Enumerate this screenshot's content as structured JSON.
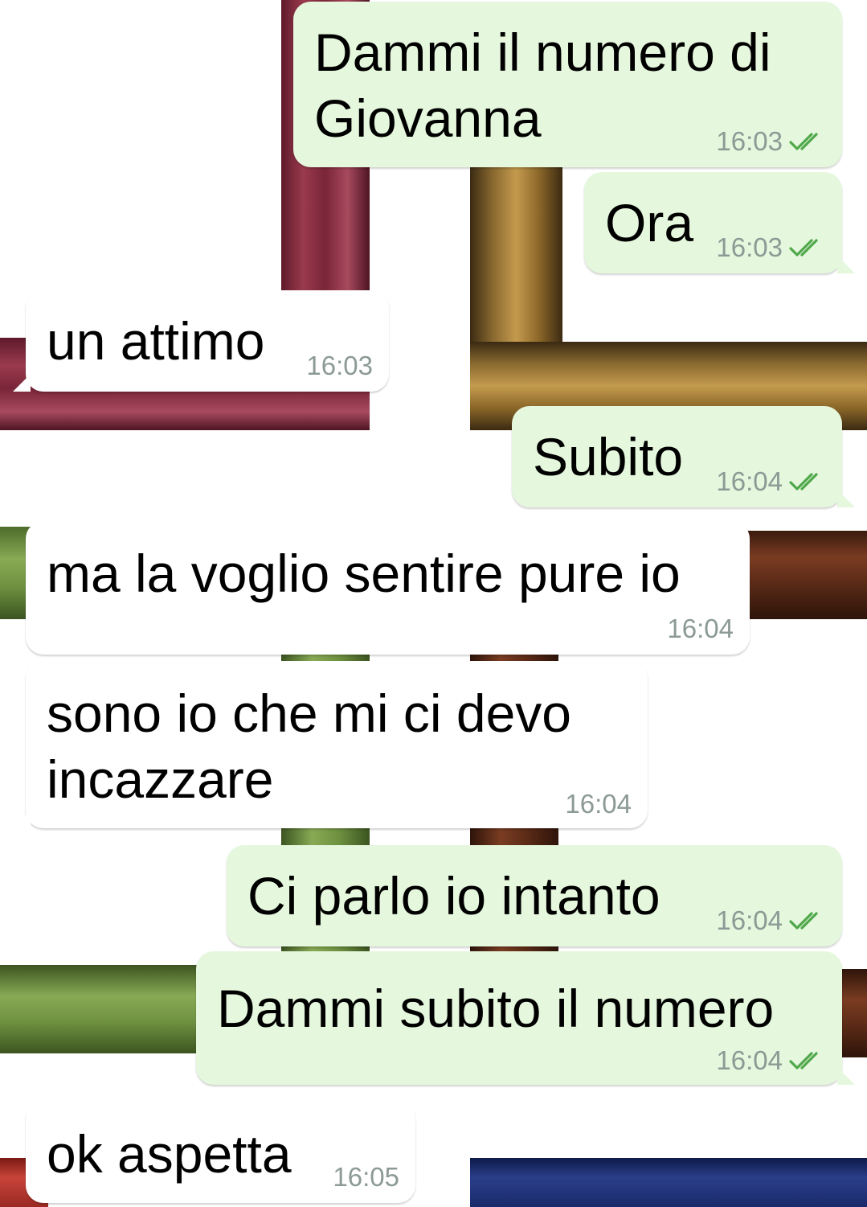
{
  "chat": {
    "messages": [
      {
        "text": "Dammi il numero di\nGiovanna",
        "time": "16:03",
        "direction": "outgoing",
        "status": "read"
      },
      {
        "text": "Ora",
        "time": "16:03",
        "direction": "outgoing",
        "status": "read"
      },
      {
        "text": "un attimo",
        "time": "16:03",
        "direction": "incoming"
      },
      {
        "text": "Subito",
        "time": "16:04",
        "direction": "outgoing",
        "status": "read"
      },
      {
        "text": "ma la voglio sentire pure io",
        "time": "16:04",
        "direction": "incoming"
      },
      {
        "text": "sono io che mi ci devo\nincazzare",
        "time": "16:04",
        "direction": "incoming"
      },
      {
        "text": "Ci parlo io intanto",
        "time": "16:04",
        "direction": "outgoing",
        "status": "read"
      },
      {
        "text": "Dammi subito il numero",
        "time": "16:04",
        "direction": "outgoing",
        "status": "read"
      },
      {
        "text": "ok aspetta",
        "time": "16:05",
        "direction": "incoming"
      }
    ]
  },
  "colors": {
    "outgoing_bubble": "#e5f7dd",
    "incoming_bubble": "#ffffff",
    "timestamp": "#8c9a95",
    "read_ticks": "#4fa84a"
  },
  "icons": {
    "read_status": "double-check-icon"
  }
}
